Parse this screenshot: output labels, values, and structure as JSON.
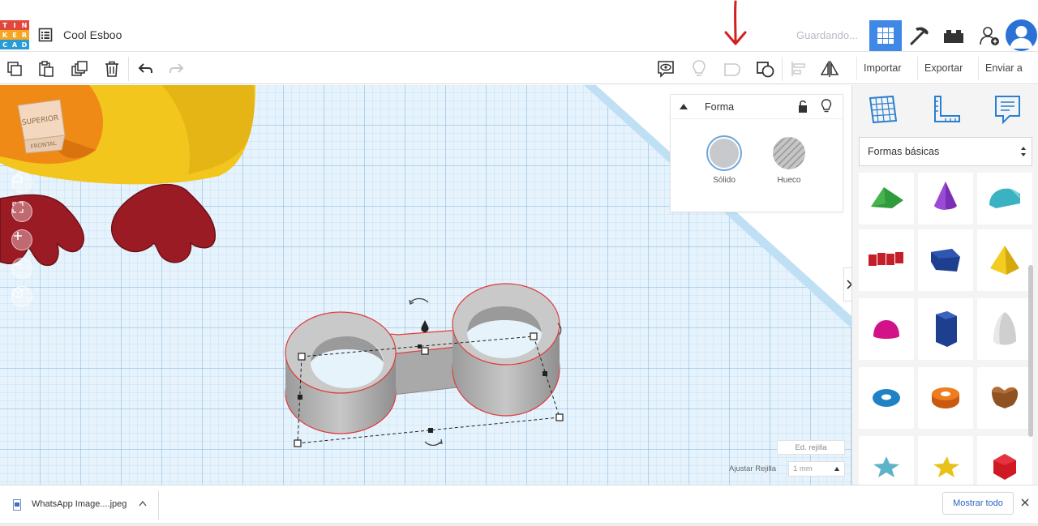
{
  "app": {
    "logo_letters": [
      "T",
      "I",
      "N",
      "K",
      "E",
      "R",
      "C",
      "A",
      "D"
    ],
    "logo_colors": [
      "#e1473c",
      "#e1473c",
      "#e1473c",
      "#f5a623",
      "#f5a623",
      "#f5a623",
      "#2b9bd6",
      "#2b9bd6",
      "#2b9bd6"
    ],
    "project_title": "Cool Esboo",
    "save_status": "Guardando...",
    "accent_color": "#3f88e6"
  },
  "toolbar": {
    "import_label": "Importar",
    "export_label": "Exportar",
    "send_label": "Enviar a"
  },
  "shape_panel": {
    "title": "Forma",
    "solid_label": "Sólido",
    "hole_label": "Hueco"
  },
  "sidebar": {
    "category_select": "Formas básicas",
    "shapes": [
      "wedge",
      "cone",
      "half-cylinder",
      "text",
      "polygon",
      "pyramid",
      "half-sphere",
      "hexagonal-prism",
      "paraboloid",
      "torus",
      "tube",
      "heart",
      "star",
      "star-yellow",
      "icosahedron"
    ]
  },
  "grid": {
    "edit_grid_label": "Ed. rejilla",
    "snap_label": "Ajustar Rejilla",
    "snap_value": "1 mm"
  },
  "view_cube": {
    "top_label": "SUPERIOR",
    "front_label": "FRONTAL"
  },
  "downloads": {
    "file_name": "WhatsApp Image....jpeg",
    "show_all_label": "Mostrar todo"
  }
}
